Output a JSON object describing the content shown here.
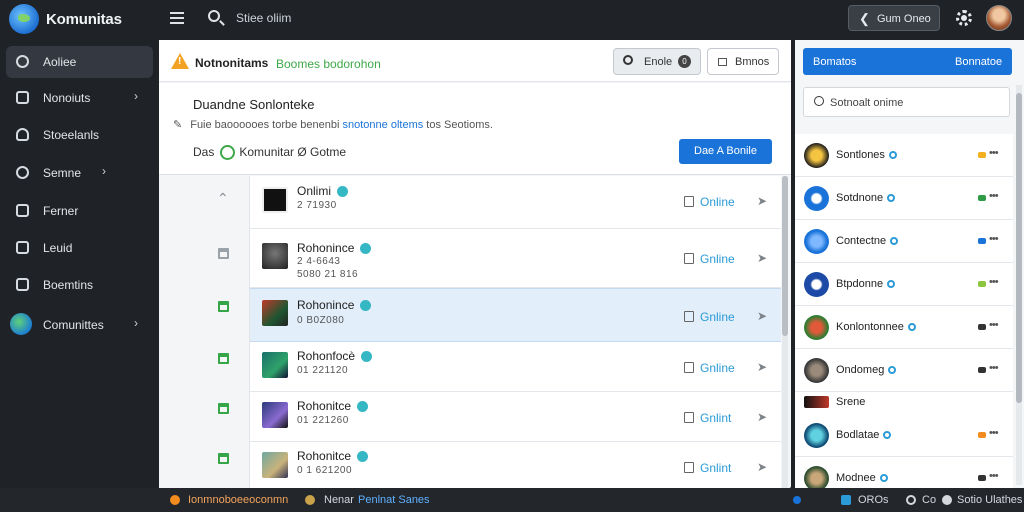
{
  "app": {
    "brand": "Komunitas"
  },
  "topbar": {
    "search_placeholder": "Stiee oliim",
    "game_button_label": "Gum Oneo"
  },
  "sidebar": {
    "items": [
      {
        "label": "Aoliee",
        "icon": "home-icon",
        "active": true,
        "has_chevron": false
      },
      {
        "label": "Nonoiuts",
        "icon": "grid-icon",
        "active": false,
        "has_chevron": true
      },
      {
        "label": "Stoeelanls",
        "icon": "user-icon",
        "active": false,
        "has_chevron": false
      },
      {
        "label": "Semne",
        "icon": "share-icon",
        "active": false,
        "has_chevron": true
      },
      {
        "label": "Ferner",
        "icon": "book-icon",
        "active": false,
        "has_chevron": false
      },
      {
        "label": "Leuid",
        "icon": "board-icon",
        "active": false,
        "has_chevron": false
      },
      {
        "label": "Boemtins",
        "icon": "bag-icon",
        "active": false,
        "has_chevron": false
      },
      {
        "label": "Comunittes",
        "icon": "globe-icon",
        "active": false,
        "has_chevron": true
      }
    ]
  },
  "main": {
    "title": "Notnonitams",
    "subtitle": "Boomes bodorohon",
    "online_button": {
      "label": "Enole",
      "count": "0"
    },
    "rooms_button": {
      "label": "Bmnos"
    },
    "info": {
      "title": "Duandne Sonlonteke",
      "line_prefix": "Fuie baoooooes torbe benenbi",
      "line_link": "snotonne oltems",
      "line_suffix": "tos Seotioms.",
      "owner_prefix": "Das",
      "owner_name": "Komunitar Ø Gotme",
      "add_button": "Dae A Bonile"
    },
    "rows": [
      {
        "name": "Onlimi",
        "meta": "2 71930",
        "meta2": "",
        "status": "Online",
        "gutter": "chevron-up",
        "selected": false
      },
      {
        "name": "Rohonince",
        "meta": "2 4-6643",
        "meta2": "5080 21 816",
        "status": "Gnline",
        "gutter": "grey",
        "selected": false
      },
      {
        "name": "Rohonince",
        "meta": "0 B0Z080",
        "meta2": "",
        "status": "Gnline",
        "gutter": "green",
        "selected": true
      },
      {
        "name": "Rohonfocè",
        "meta": "01 221120",
        "meta2": "",
        "status": "Gnline",
        "gutter": "green",
        "selected": false
      },
      {
        "name": "Rohonitce",
        "meta": "01 221260",
        "meta2": "",
        "status": "Gnlint",
        "gutter": "green",
        "selected": false
      },
      {
        "name": "Rohonitce",
        "meta": "0 1 621200",
        "meta2": "",
        "status": "Gnlint",
        "gutter": "green",
        "selected": false
      }
    ]
  },
  "right": {
    "header_left": "Bomatos",
    "header_right": "Bonnatoe",
    "search_placeholder": "Sotnoalt onime",
    "items": [
      {
        "name": "Sontlones",
        "status_color": "#f2b01e",
        "has_dot": true
      },
      {
        "name": "Sotdnone",
        "status_color": "#2e9b45",
        "has_dot": true
      },
      {
        "name": "Contectne",
        "status_color": "#1a73d9",
        "has_dot": true
      },
      {
        "name": "Btpdonne",
        "status_color": "#8cc63f",
        "has_dot": true
      },
      {
        "name": "Konlontonnee",
        "status_color": "#333333",
        "has_dot": true
      },
      {
        "name": "Ondomeg",
        "status_color": "#333333",
        "has_dot": true
      },
      {
        "name": "Srene",
        "status_color": "",
        "has_dot": false
      },
      {
        "name": "Bodlatae",
        "status_color": "#f28c1e",
        "has_dot": true
      },
      {
        "name": "Modnee",
        "status_color": "#333333",
        "has_dot": true
      }
    ]
  },
  "statusbar": {
    "left_text": "Ionmnoboeeoconmn",
    "mid_prefix": "Nenar",
    "mid_link": "Penlnat Sanes",
    "right_a": "OROs",
    "right_b": "Co",
    "right_c": "Sotio Ulathes"
  }
}
